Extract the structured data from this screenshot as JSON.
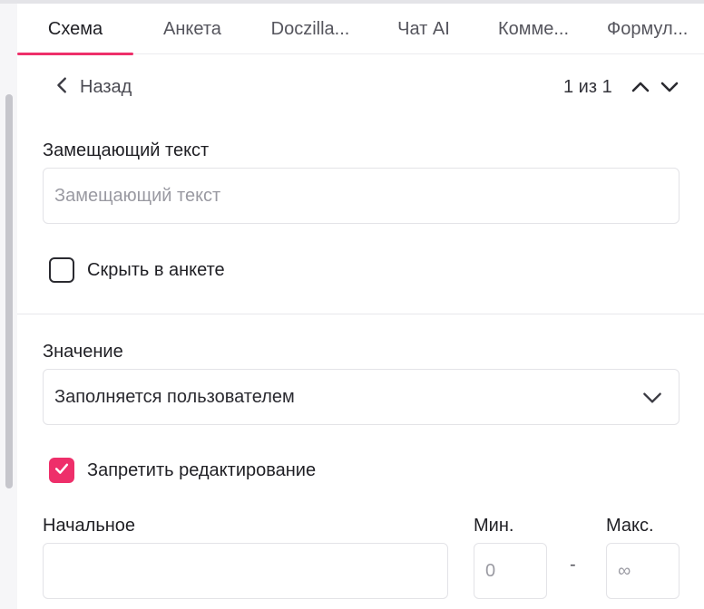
{
  "tabs": [
    {
      "label": "Схема",
      "active": true
    },
    {
      "label": "Анкета",
      "active": false
    },
    {
      "label": "Doczilla...",
      "active": false
    },
    {
      "label": "Чат AI",
      "active": false
    },
    {
      "label": "Комме...",
      "active": false
    },
    {
      "label": "Формул...",
      "active": false
    }
  ],
  "nav": {
    "back_label": "Назад",
    "pager": "1 из 1"
  },
  "placeholder_field": {
    "label": "Замещающий текст",
    "placeholder": "Замещающий текст",
    "value": ""
  },
  "hide_checkbox": {
    "label": "Скрыть в анкете",
    "checked": false
  },
  "value_field": {
    "label": "Значение",
    "selected": "Заполняется пользователем"
  },
  "forbid_checkbox": {
    "label": "Запретить редактирование",
    "checked": true
  },
  "initial_field": {
    "label": "Начальное",
    "value": ""
  },
  "min_field": {
    "label": "Мин.",
    "placeholder": "0"
  },
  "range_separator": "-",
  "max_field": {
    "label": "Макс.",
    "placeholder": "∞"
  },
  "colors": {
    "accent": "#ee2f6a",
    "text": "#1f1f24",
    "border": "#e3e3e7"
  }
}
